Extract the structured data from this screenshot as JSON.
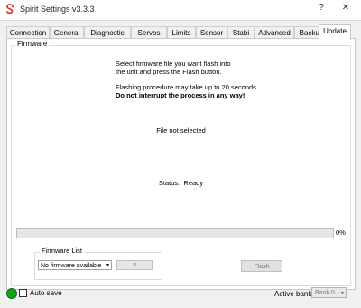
{
  "window": {
    "title": "Spirit Settings v3.3.3",
    "help_label": "?",
    "close_label": "✕"
  },
  "tabs": [
    {
      "label": "Connection",
      "active": false
    },
    {
      "label": "General",
      "active": false
    },
    {
      "label": "Diagnostic",
      "active": false
    },
    {
      "label": "Servos",
      "active": false
    },
    {
      "label": "Limits",
      "active": false
    },
    {
      "label": "Sensor",
      "active": false
    },
    {
      "label": "Stabi",
      "active": false
    },
    {
      "label": "Advanced",
      "active": false
    },
    {
      "label": "Backup",
      "active": false
    },
    {
      "label": "Update",
      "active": true
    }
  ],
  "firmware": {
    "legend": "Firmware",
    "instruction_line1": "Select firmware file you want flash into",
    "instruction_line2": "the unit and press the Flash button.",
    "flash_note": "Flashing procedure may take up to 20 seconds.",
    "warning": "Do not interrupt the process in any way!",
    "file_status": "File not selected",
    "status_label": "Status:",
    "status_value": "Ready",
    "progress_percent": 0,
    "progress_text": "0%",
    "list_legend": "Firmware List",
    "list_selected": "No firmware available",
    "question_label": "?",
    "flash_label": "Flash"
  },
  "footer": {
    "autosave_label": "Auto save",
    "autosave_checked": false,
    "bank_label": "Active bank:",
    "bank_value": "Bank 0"
  },
  "colors": {
    "status_indicator": "#12a51a",
    "app_icon": "#d32f2f"
  }
}
